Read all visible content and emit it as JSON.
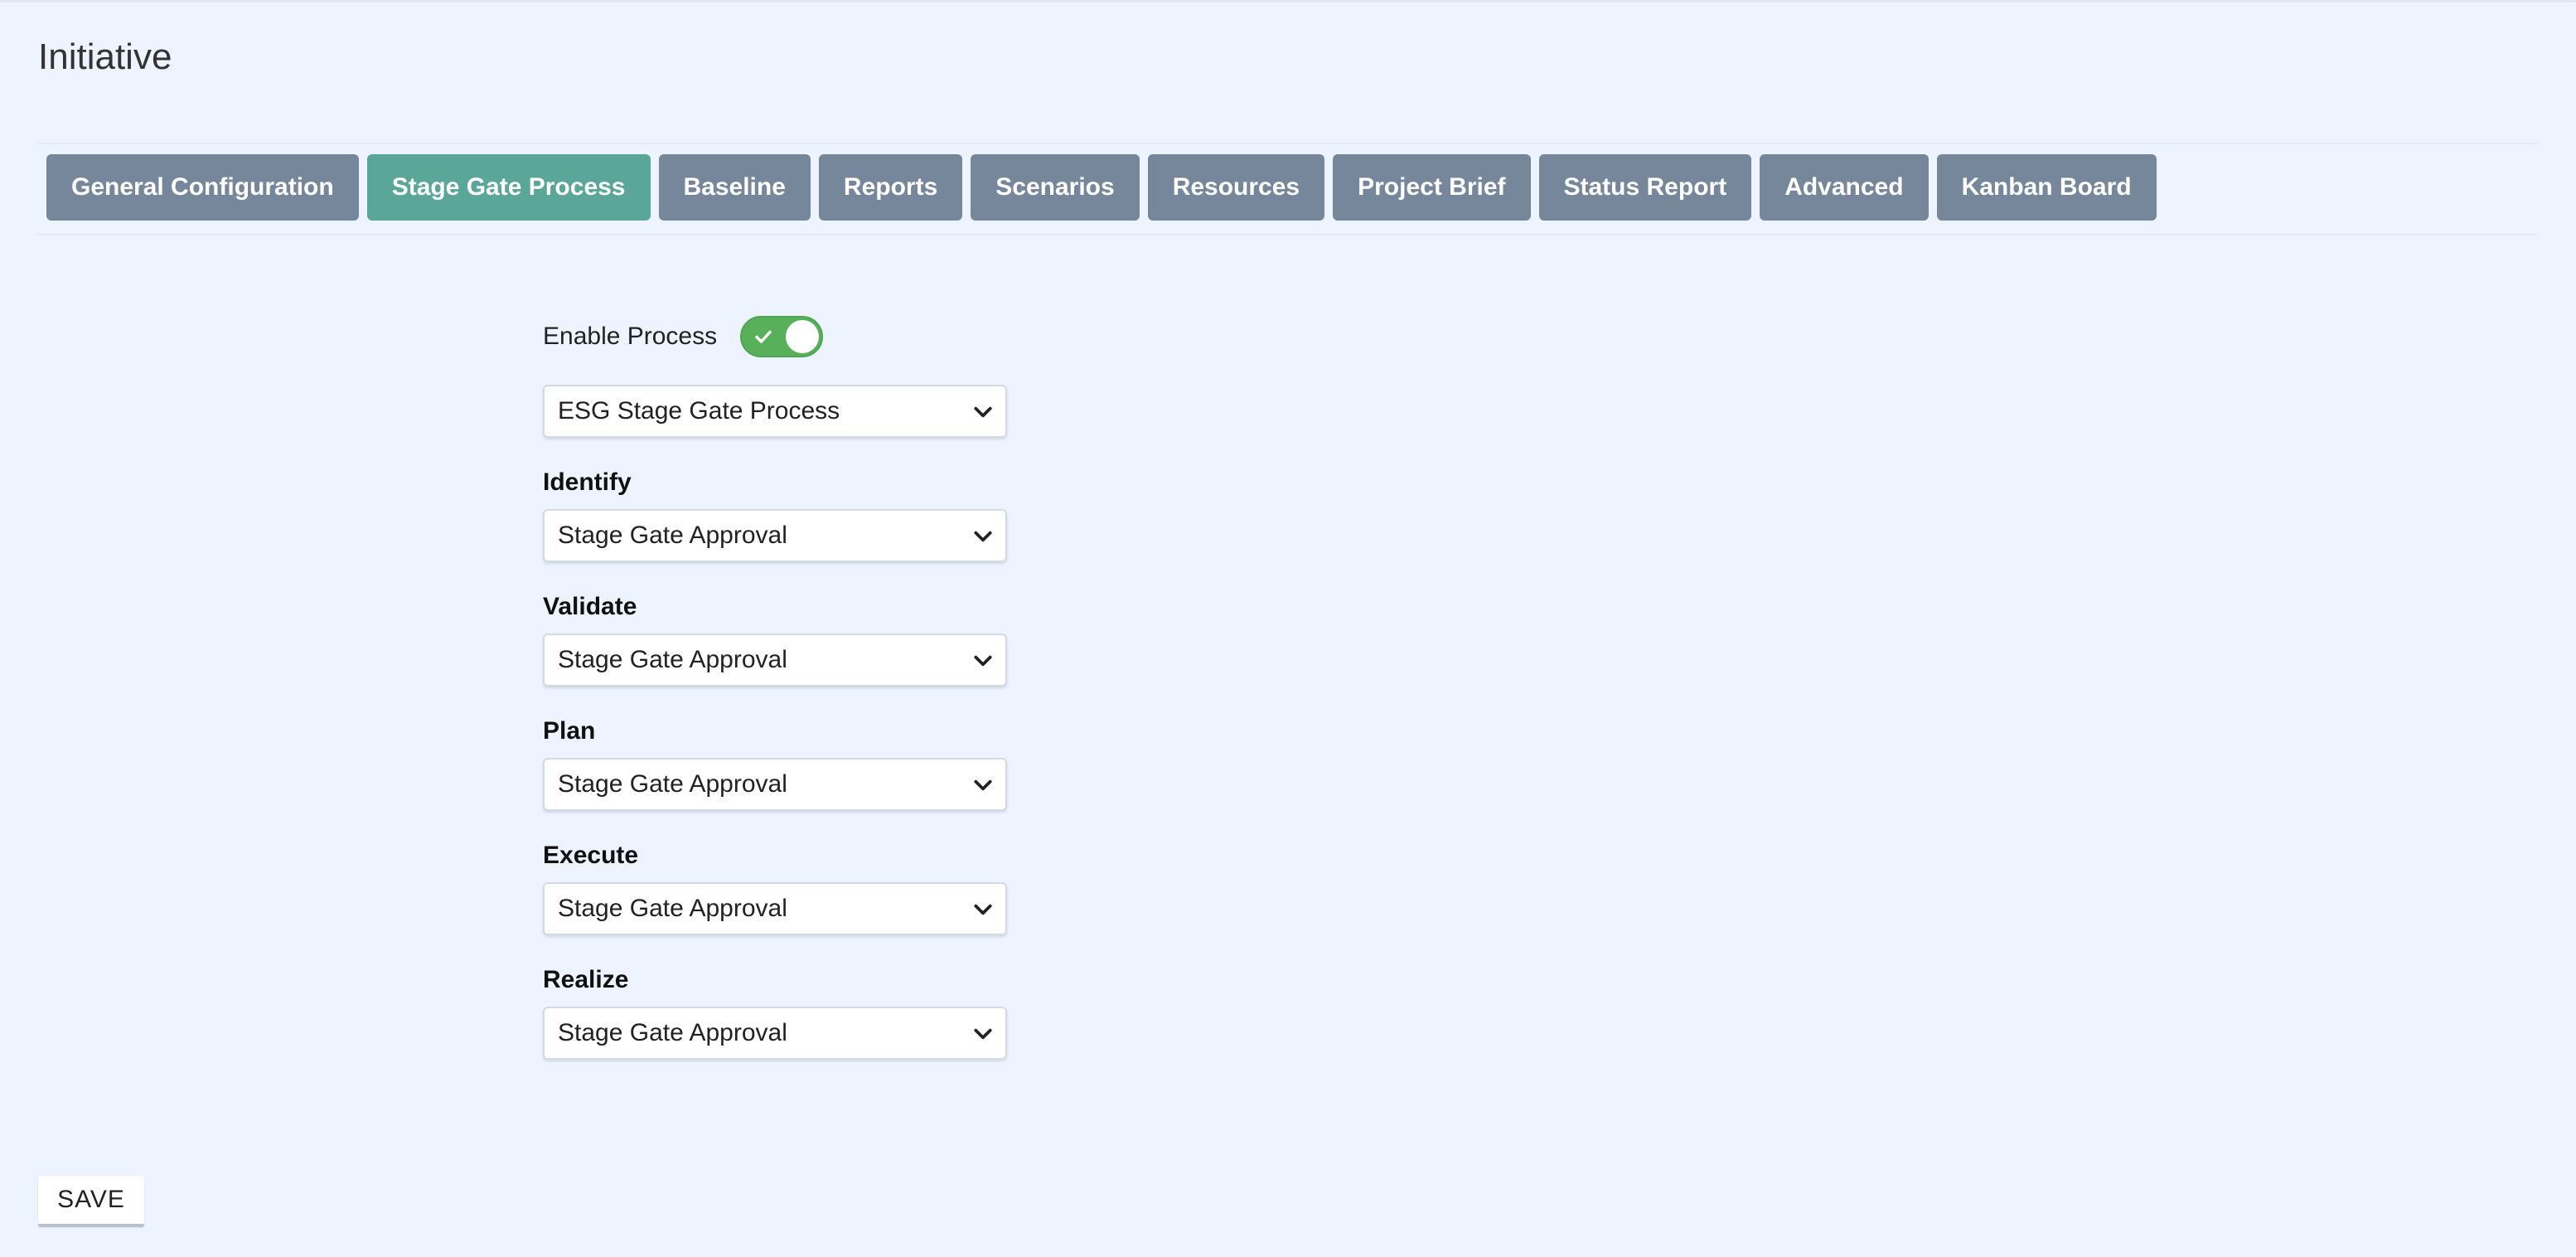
{
  "page": {
    "title": "Initiative"
  },
  "tabs": [
    {
      "label": "General Configuration"
    },
    {
      "label": "Stage Gate Process",
      "active": true
    },
    {
      "label": "Baseline"
    },
    {
      "label": "Reports"
    },
    {
      "label": "Scenarios"
    },
    {
      "label": "Resources"
    },
    {
      "label": "Project Brief"
    },
    {
      "label": "Status Report"
    },
    {
      "label": "Advanced"
    },
    {
      "label": "Kanban Board"
    }
  ],
  "form": {
    "enable_label": "Enable Process",
    "enable_on": true,
    "process_value": "ESG Stage Gate Process",
    "stages": [
      {
        "label": "Identify",
        "value": "Stage Gate Approval"
      },
      {
        "label": "Validate",
        "value": "Stage Gate Approval"
      },
      {
        "label": "Plan",
        "value": "Stage Gate Approval"
      },
      {
        "label": "Execute",
        "value": "Stage Gate Approval"
      },
      {
        "label": "Realize",
        "value": "Stage Gate Approval"
      }
    ]
  },
  "actions": {
    "save_label": "SAVE"
  },
  "colors": {
    "background": "#edf4ff",
    "tab": "#76879c",
    "tab_active": "#5aa79a",
    "toggle_on": "#58b05a"
  },
  "icons": {
    "toggle": "check-icon",
    "select": "chevron-down-icon"
  }
}
